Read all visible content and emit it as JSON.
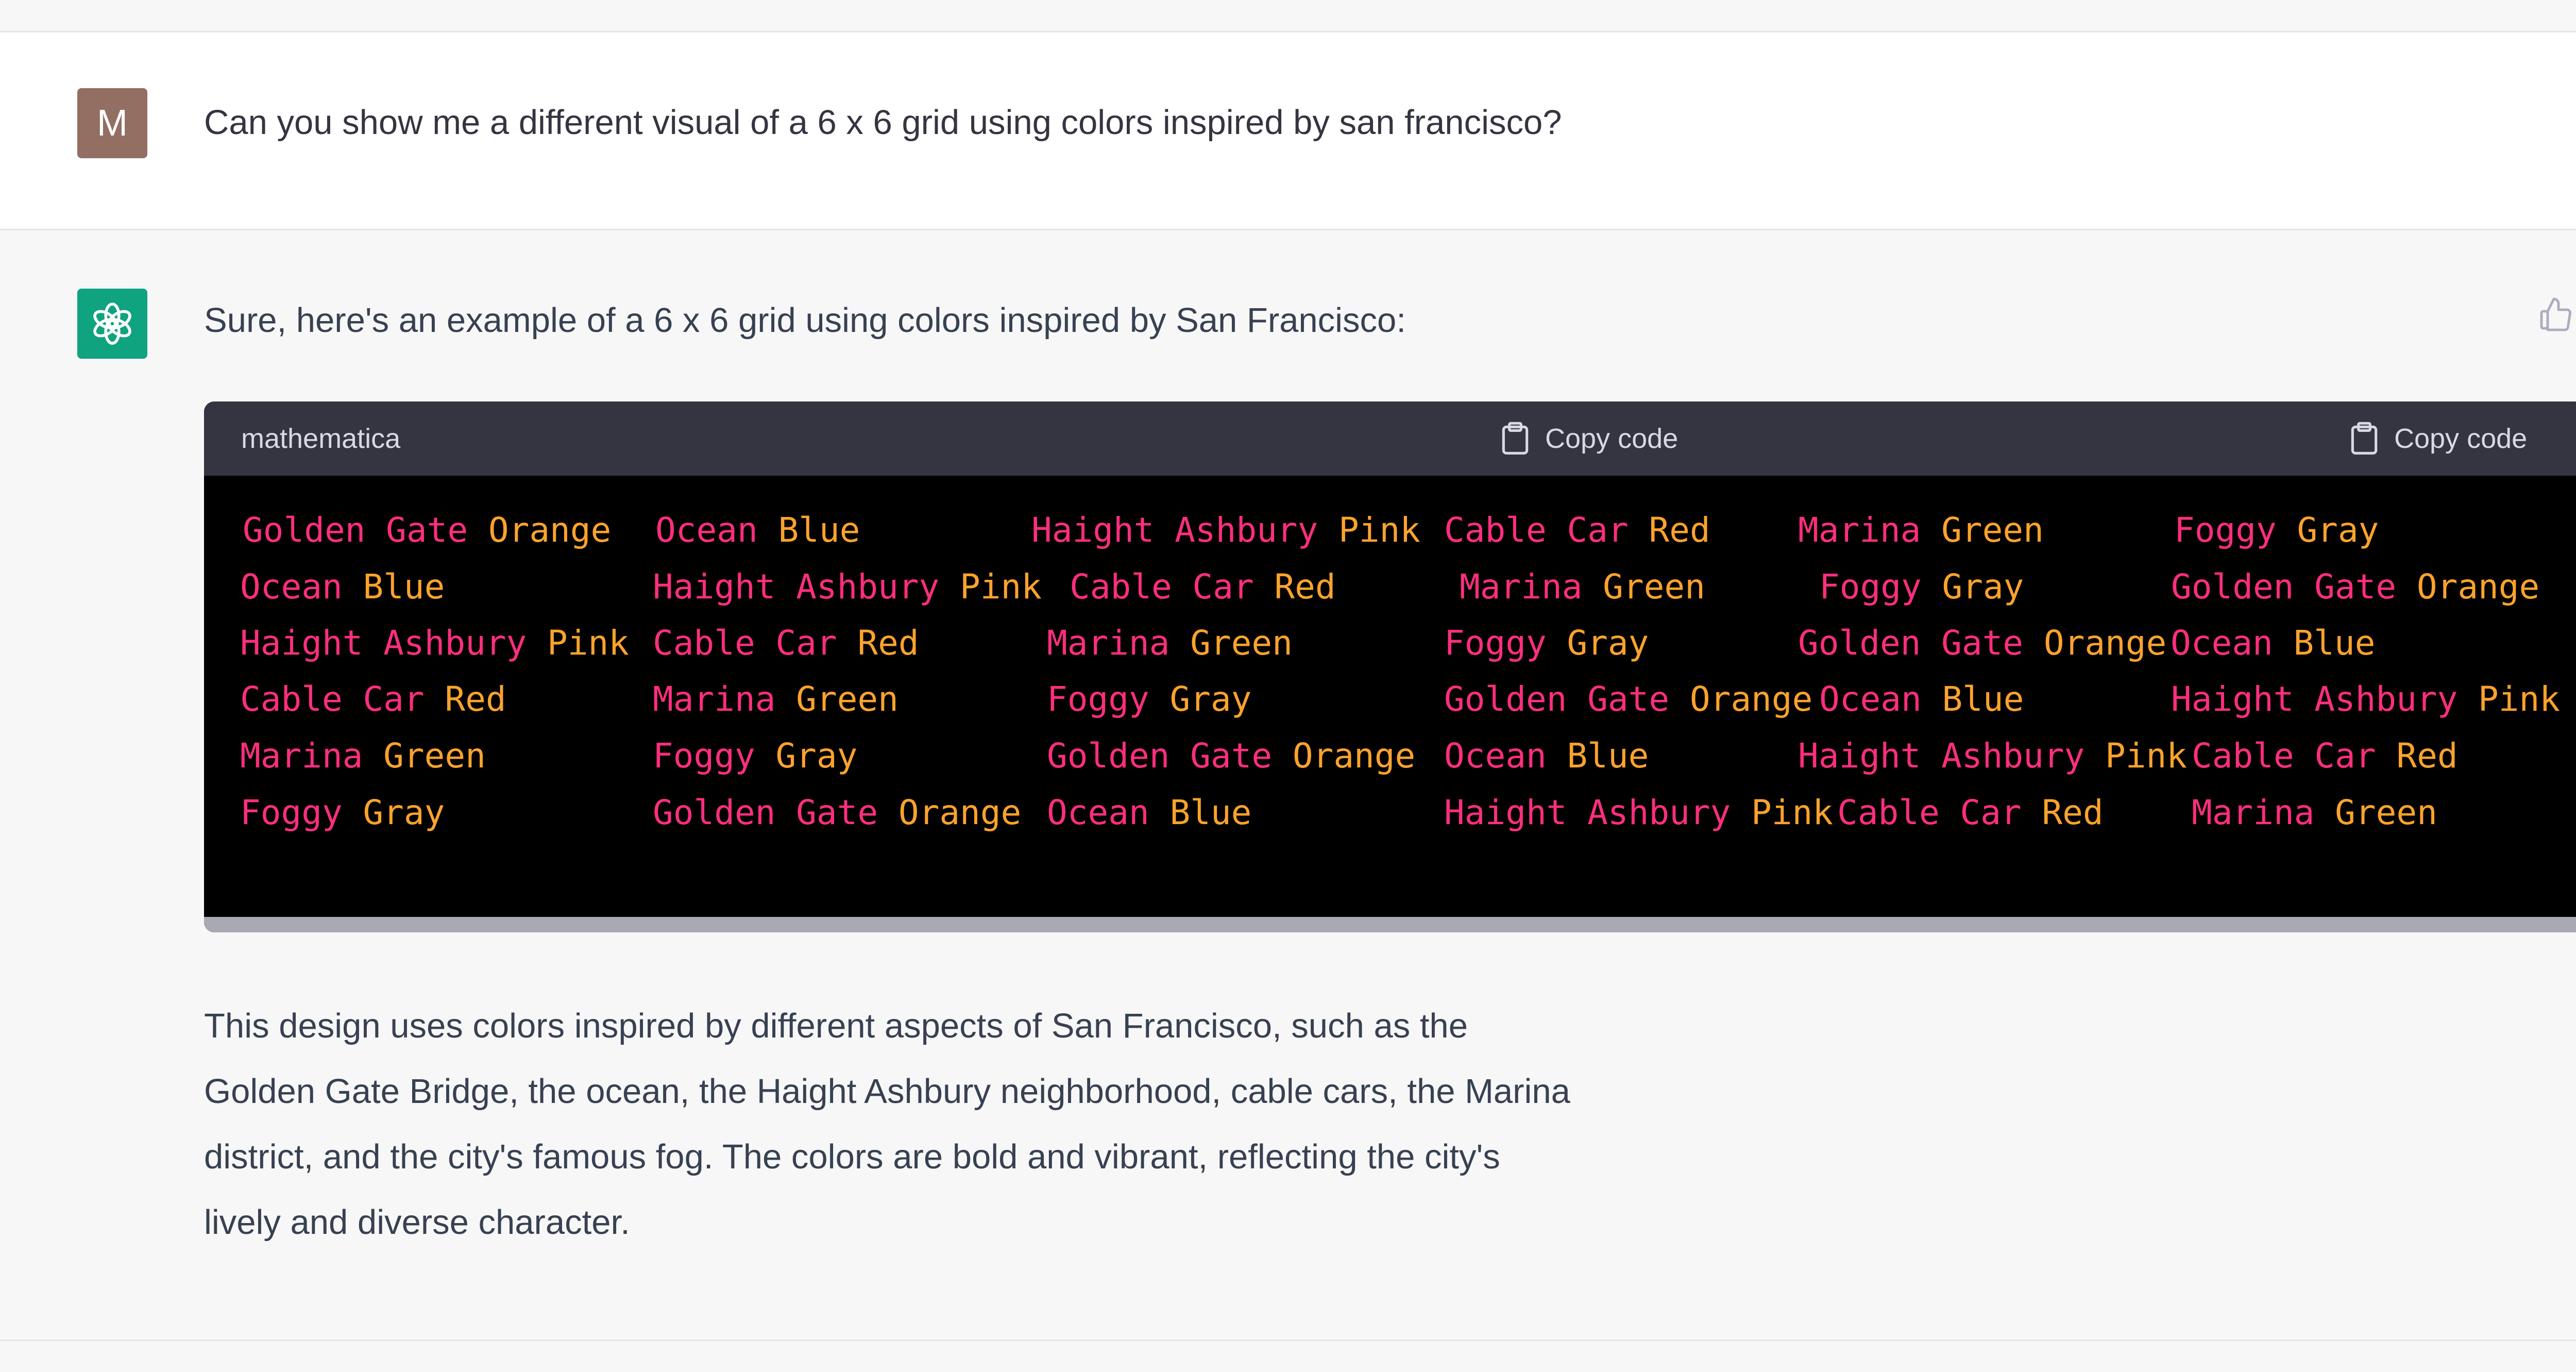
{
  "user": {
    "avatar_letter": "M",
    "avatar_color": "#936e63",
    "message": "Can you show me a different visual of a 6 x 6 grid using colors inspired by san francisco?"
  },
  "assistant": {
    "avatar_icon": "openai-logo-icon",
    "avatar_color": "#10a37f",
    "intro": "Sure, here's an example of a 6 x 6 grid using colors inspired by San Francisco:",
    "code_block": {
      "language": "mathematica",
      "copy_label": "Copy code",
      "copy_label_2": "Copy code",
      "name_color": "#ff2e7e",
      "color_word_color": "#fca32c",
      "rows": [
        [
          {
            "name": "Golden Gate",
            "color": "Orange"
          },
          {
            "name": "Ocean",
            "color": "Blue"
          },
          {
            "name": "Haight Ashbury",
            "color": "Pink"
          },
          {
            "name": "Cable Car",
            "color": "Red"
          },
          {
            "name": "Marina",
            "color": "Green"
          },
          {
            "name": "Foggy",
            "color": "Gray"
          }
        ],
        [
          {
            "name": "Ocean",
            "color": "Blue"
          },
          {
            "name": "Haight Ashbury",
            "color": "Pink"
          },
          {
            "name": "Cable Car",
            "color": "Red"
          },
          {
            "name": "Marina",
            "color": "Green"
          },
          {
            "name": "Foggy",
            "color": "Gray"
          },
          {
            "name": "Golden Gate",
            "color": "Orange"
          }
        ],
        [
          {
            "name": "Haight Ashbury",
            "color": "Pink"
          },
          {
            "name": "Cable Car",
            "color": "Red"
          },
          {
            "name": "Marina",
            "color": "Green"
          },
          {
            "name": "Foggy",
            "color": "Gray"
          },
          {
            "name": "Golden Gate",
            "color": "Orange"
          },
          {
            "name": "Ocean",
            "color": "Blue"
          }
        ],
        [
          {
            "name": "Cable Car",
            "color": "Red"
          },
          {
            "name": "Marina",
            "color": "Green"
          },
          {
            "name": "Foggy",
            "color": "Gray"
          },
          {
            "name": "Golden Gate",
            "color": "Orange"
          },
          {
            "name": "Ocean",
            "color": "Blue"
          },
          {
            "name": "Haight Ashbury",
            "color": "Pink"
          }
        ],
        [
          {
            "name": "Marina",
            "color": "Green"
          },
          {
            "name": "Foggy",
            "color": "Gray"
          },
          {
            "name": "Golden Gate",
            "color": "Orange"
          },
          {
            "name": "Ocean",
            "color": "Blue"
          },
          {
            "name": "Haight Ashbury",
            "color": "Pink"
          },
          {
            "name": "Cable Car",
            "color": "Red"
          }
        ],
        [
          {
            "name": "Foggy",
            "color": "Gray"
          },
          {
            "name": "Golden Gate",
            "color": "Orange"
          },
          {
            "name": "Ocean",
            "color": "Blue"
          },
          {
            "name": "Haight Ashbury",
            "color": "Pink"
          },
          {
            "name": "Cable Car",
            "color": "Red"
          },
          {
            "name": "Marina",
            "color": "Green"
          }
        ]
      ]
    },
    "paragraph_lines": [
      "This design uses colors inspired by different aspects of San Francisco, such as the",
      "Golden Gate Bridge, the ocean, the Haight Ashbury neighborhood, cable cars, the Marina",
      "district, and the city's famous fog. The colors are bold and vibrant, reflecting the city's",
      "lively and diverse character."
    ]
  },
  "feedback": {
    "thumbs_up_icon": "thumbs-up-icon",
    "thumbs_down_icon": "thumbs-down-icon"
  }
}
